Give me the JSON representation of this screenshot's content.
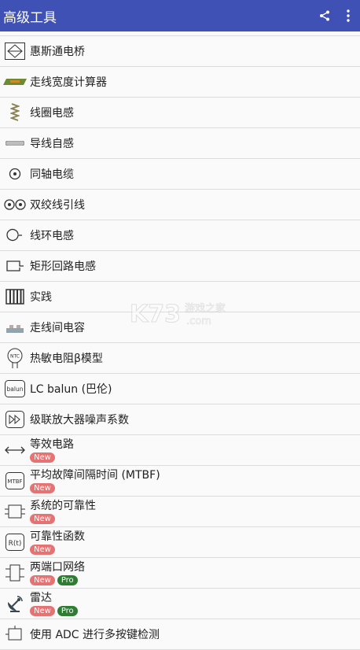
{
  "app_bar": {
    "title": "高级工具",
    "share_icon": "share-icon",
    "menu_icon": "more-vert-icon"
  },
  "tools": [
    {
      "label": "惠斯通电桥",
      "icon": "wheatstone-bridge-icon"
    },
    {
      "label": "走线宽度计算器",
      "icon": "trace-width-icon"
    },
    {
      "label": "线圈电感",
      "icon": "coil-icon"
    },
    {
      "label": "导线自感",
      "icon": "wire-icon"
    },
    {
      "label": "同轴电缆",
      "icon": "coax-icon"
    },
    {
      "label": "双绞线引线",
      "icon": "twisted-pair-icon"
    },
    {
      "label": "线环电感",
      "icon": "wire-loop-icon"
    },
    {
      "label": "矩形回路电感",
      "icon": "rect-loop-icon"
    },
    {
      "label": "实践",
      "icon": "comb-icon"
    },
    {
      "label": "走线间电容",
      "icon": "trace-capacitance-icon"
    },
    {
      "label": "热敏电阻β模型",
      "icon": "ntc-thermistor-icon",
      "icon_text": "NTC"
    },
    {
      "label": "LC balun (巴伦)",
      "icon": "balun-icon",
      "icon_text": "balun"
    },
    {
      "label": "级联放大器噪声系数",
      "icon": "cascade-amp-icon"
    },
    {
      "label": "等效电路",
      "icon": "double-arrow-icon",
      "badges": [
        "New"
      ]
    },
    {
      "label": "平均故障间隔时间 (MTBF)",
      "icon": "mtbf-icon",
      "icon_text": "MTBF",
      "badges": [
        "New"
      ]
    },
    {
      "label": "系统的可靠性",
      "icon": "system-reliability-icon",
      "badges": [
        "New"
      ]
    },
    {
      "label": "可靠性函数",
      "icon": "reliability-function-icon",
      "icon_text": "R(t)",
      "badges": [
        "New"
      ]
    },
    {
      "label": "两端口网络",
      "icon": "two-port-icon",
      "badges": [
        "New",
        "Pro"
      ]
    },
    {
      "label": "雷达",
      "icon": "radar-icon",
      "badges": [
        "New",
        "Pro"
      ]
    },
    {
      "label": "使用 ADC 进行多按键检测",
      "icon": "adc-icon"
    }
  ],
  "watermark": {
    "brand": "K73",
    "site_name": "游戏之家",
    "domain": ".com"
  },
  "colors": {
    "app_bar": "#3f51b5",
    "badge_new": "#e57373",
    "badge_pro": "#2e7d32"
  }
}
